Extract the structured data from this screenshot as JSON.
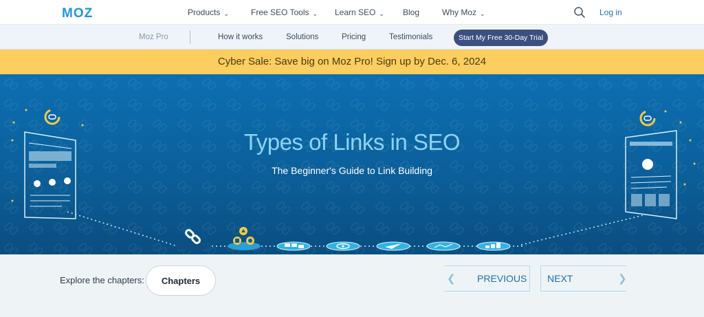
{
  "header": {
    "logo": "MOZ",
    "nav": [
      {
        "label": "Products",
        "chevron": true
      },
      {
        "label": "Free SEO Tools",
        "chevron": true
      },
      {
        "label": "Learn SEO",
        "chevron": true
      },
      {
        "label": "Blog",
        "chevron": false
      },
      {
        "label": "Why Moz",
        "chevron": true
      }
    ],
    "search_icon": "search-icon",
    "login": "Log in"
  },
  "subnav": {
    "brand": "Moz Pro",
    "items": [
      "How it works",
      "Solutions",
      "Pricing",
      "Testimonials"
    ],
    "cta": "Start My Free 30-Day Trial"
  },
  "banner": {
    "text": "Cyber Sale: Save big on Moz Pro! Sign up by Dec. 6, 2024"
  },
  "hero": {
    "title": "Types of Links in SEO",
    "subtitle": "The Beginner's Guide to Link Building"
  },
  "chapters": {
    "label": "Explore the chapters:",
    "button": "Chapters",
    "previous": "PREVIOUS",
    "next": "NEXT",
    "prev_icon": "chevron-left-icon",
    "next_icon": "chevron-right-icon"
  },
  "colors": {
    "brand_blue": "#1b9ad6",
    "banner_yellow": "#fccd5f",
    "hero_blue": "#0b5f9a",
    "cta_navy": "#3d4f7e",
    "hero_title": "#8fd3f2"
  }
}
